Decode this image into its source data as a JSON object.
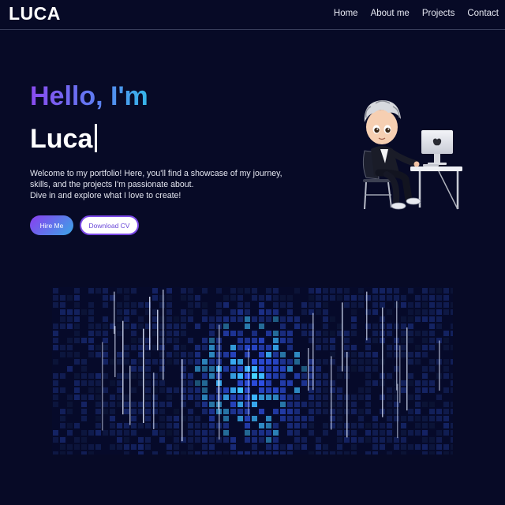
{
  "nav": {
    "logo": "LUCA",
    "links": [
      "Home",
      "About me",
      "Projects",
      "Contact"
    ]
  },
  "hero": {
    "greeting": "Hello, I'm",
    "name": "Luca",
    "intro_line1": "Welcome to my portfolio! Here, you'll find a showcase of my journey, skills, and the projects I'm passionate about.",
    "intro_line2": "Dive in and explore what I love to create!",
    "hire_label": "Hire Me",
    "cv_label": "Download CV"
  },
  "colors": {
    "background": "#070a26",
    "gradient_start": "#8a4bf0",
    "gradient_end": "#35b6e8"
  }
}
